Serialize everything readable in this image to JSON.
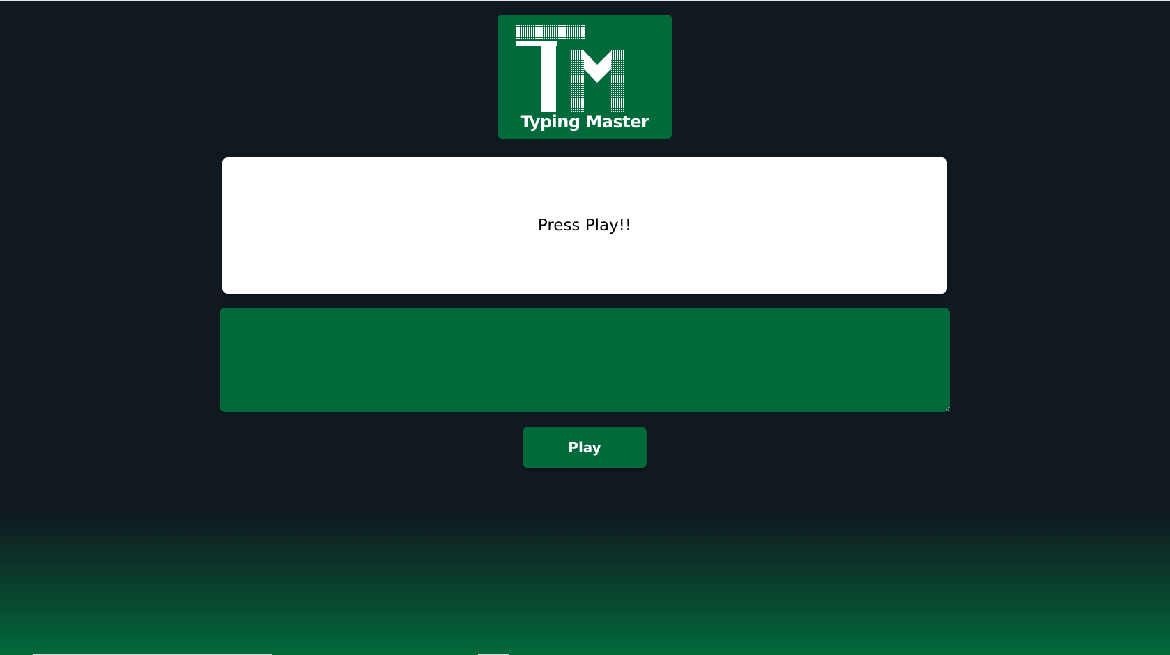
{
  "logo": {
    "text": "Typing Master",
    "icon": "tm-logo-icon",
    "background": "#016a3a"
  },
  "display": {
    "message": "Press Play!!"
  },
  "typing_area": {
    "value": "",
    "placeholder": ""
  },
  "controls": {
    "play_label": "Play"
  },
  "colors": {
    "background": "#101820",
    "accent": "#016a3a",
    "text_on_accent": "#ffffff"
  }
}
